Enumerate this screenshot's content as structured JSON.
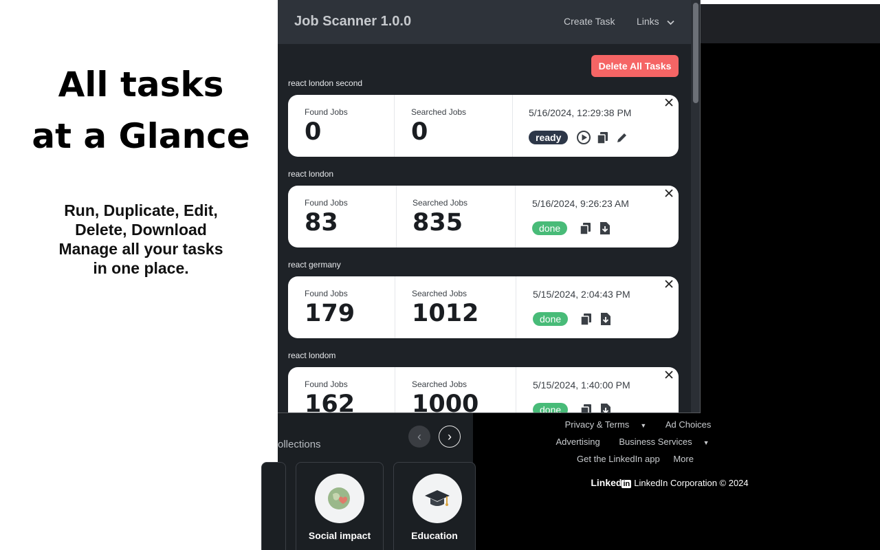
{
  "promo": {
    "title_line1": "All tasks",
    "title_line2": "at a Glance",
    "sub_line1": "Run, Duplicate, Edit,",
    "sub_line2": "Delete, Download",
    "sub_line3": "Manage all your tasks",
    "sub_line4": "in one place."
  },
  "popup": {
    "app_title": "Job Scanner 1.0.0",
    "nav": {
      "create_task": "Create Task",
      "links": "Links"
    },
    "delete_all_label": "Delete All Tasks",
    "found_label": "Found Jobs",
    "searched_label": "Searched Jobs",
    "tasks": [
      {
        "name": "react london second",
        "found": "0",
        "searched": "0",
        "date": "5/16/2024, 12:29:38 PM",
        "status": "ready"
      },
      {
        "name": "react london",
        "found": "83",
        "searched": "835",
        "date": "5/16/2024, 9:26:23 AM",
        "status": "done"
      },
      {
        "name": "react germany",
        "found": "179",
        "searched": "1012",
        "date": "5/15/2024, 2:04:43 PM",
        "status": "done"
      },
      {
        "name": "react londom",
        "found": "162",
        "searched": "1000",
        "date": "5/15/2024, 1:40:00 PM",
        "status": "done"
      }
    ]
  },
  "background": {
    "collections_label": "ollections",
    "prev_symbol": "‹",
    "next_symbol": "›",
    "collections": [
      {
        "label": "Social impact",
        "icon": "globe-heart-icon"
      },
      {
        "label": "Education",
        "icon": "graduation-cap-icon"
      }
    ],
    "footer": {
      "privacy_terms": "Privacy & Terms",
      "ad_choices": "Ad Choices",
      "advertising": "Advertising",
      "business_services": "Business Services",
      "get_app": "Get the LinkedIn app",
      "more": "More",
      "brand_text": "Linked",
      "brand_box": "in",
      "copyright": "LinkedIn Corporation © 2024"
    }
  },
  "colors": {
    "danger": "#f56565",
    "done": "#48bb78",
    "ready": "#2d3748",
    "popup_bg": "#1e2227",
    "header_bg": "#2e333a"
  }
}
